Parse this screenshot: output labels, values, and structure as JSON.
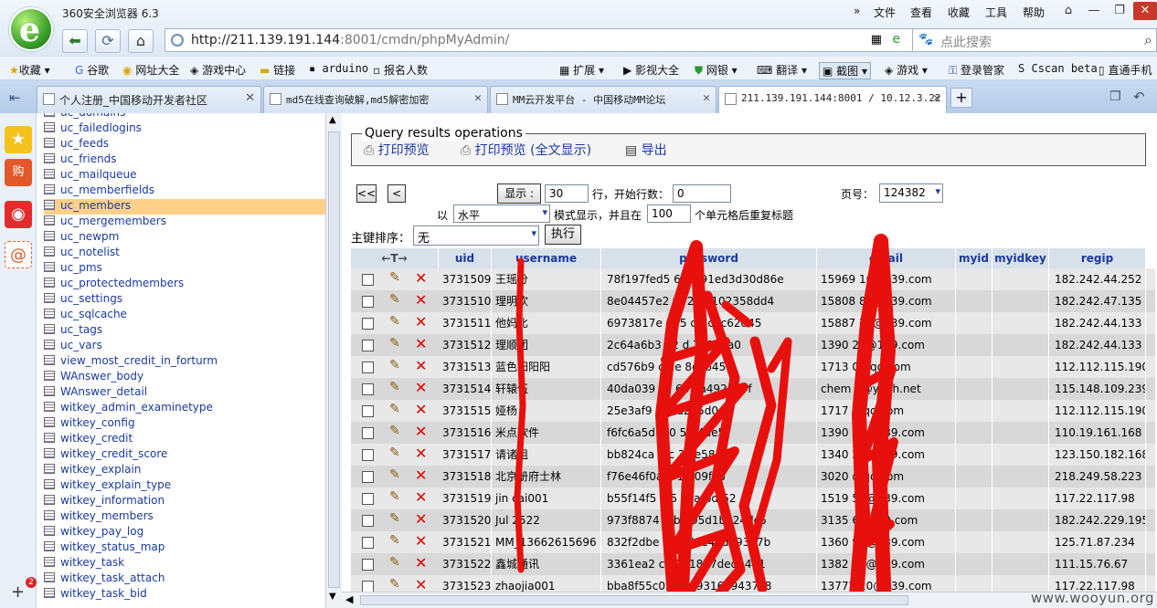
{
  "browser": {
    "app_name": "360安全浏览器 6.3",
    "menu": [
      "文件",
      "查看",
      "收藏",
      "工具",
      "帮助"
    ],
    "url_host": "http://211.139.191.144",
    "url_rest": ":8001/cmdn/phpMyAdmin/",
    "search_placeholder": "点此搜索"
  },
  "bookmarks_left": [
    "收藏",
    "谷歌",
    "网址大全",
    "游戏中心",
    "链接",
    "arduino",
    "报名人数"
  ],
  "bookmarks_right": [
    "扩展",
    "影视大全",
    "网银",
    "翻译",
    "截图",
    "游戏",
    "登录管家",
    "Cscan beta",
    "直通手机"
  ],
  "tabs": [
    "个人注册_中国移动开发者社区",
    "md5在线查询破解,md5解密加密",
    "MM云开发平台 - 中国移动MM论坛",
    "211.139.191.144:8001 / 10.12.3.22"
  ],
  "sidebar_badge": "2",
  "table_list": [
    "uc_domains",
    "uc_failedlogins",
    "uc_feeds",
    "uc_friends",
    "uc_mailqueue",
    "uc_memberfields",
    "uc_members",
    "uc_mergemembers",
    "uc_newpm",
    "uc_notelist",
    "uc_pms",
    "uc_protectedmembers",
    "uc_settings",
    "uc_sqlcache",
    "uc_tags",
    "uc_vars",
    "view_most_credit_in_forturm",
    "WAnswer_body",
    "WAnswer_detail",
    "witkey_admin_examinetype",
    "witkey_config",
    "witkey_credit",
    "witkey_credit_score",
    "witkey_explain",
    "witkey_explain_type",
    "witkey_information",
    "witkey_members",
    "witkey_pay_log",
    "witkey_status_map",
    "witkey_task",
    "witkey_task_attach",
    "witkey_task_bid"
  ],
  "selected_table": "uc_members",
  "query_ops": {
    "legend": "Query results operations",
    "print": "打印预览",
    "print_full": "打印预览 (全文显示)",
    "export": "导出"
  },
  "nav": {
    "first": "<<",
    "prev": "<",
    "show_btn": "显示 :",
    "rows_value": "30",
    "rows_label": "行，开始行数：",
    "start_value": "0",
    "page_label": "页号：",
    "page_value": "124382",
    "mode_prefix": "以",
    "mode_value": "水平",
    "mode_label": "模式显示，并且在",
    "repeat_value": "100",
    "repeat_label": "个单元格后重复标题",
    "sort_label": "主键排序：",
    "sort_value": "无",
    "exec_btn": "执行"
  },
  "columns": [
    "uid",
    "username",
    "password",
    "email",
    "myid",
    "myidkey",
    "regip"
  ],
  "rows": [
    [
      "3731509",
      "王瑶分",
      "78f197fed5    60cd91ed3d30d86e",
      "15969    16@139.com",
      "182.242.44.252"
    ],
    [
      "3731510",
      "理明欢",
      "8e04457e2   f9   26   0102358dd4",
      "15808    82@139.com",
      "182.242.47.135"
    ],
    [
      "3731511",
      "他妈比",
      "6973817e   025   d   7c5c62d45",
      "15887    73@139.com",
      "182.242.44.133"
    ],
    [
      "3731512",
      "理顺团",
      "2c64a6b3   b2   d   729a3a0",
      "1390    26@139.com",
      "182.242.44.133"
    ],
    [
      "3731513",
      "蓝色阳阳阳",
      "cd576b9   c2   e   8c8645a",
      "1713    0@qq.com",
      "112.112.115.190"
    ],
    [
      "3731514",
      "轩辕伍",
      "40da039   c1   68   aa492e09f",
      "chem    n@yeah.net",
      "115.148.109.239"
    ],
    [
      "3731515",
      "娅杨",
      "25e3af9   5   4   d2d5d049",
      "1717    @qq.com",
      "112.112.115.190"
    ],
    [
      "3731516",
      "米点软件",
      "f6fc6a5d   2   0   5f74ae5",
      "1390    67@139.com",
      "110.19.161.168"
    ],
    [
      "3731517",
      "请诸祖",
      "bb824ca   d   c   3   ce58321",
      "1340    29@139.com",
      "123.150.182.168"
    ],
    [
      "3731518",
      "北京册府士林",
      "f76e46f0a   4   1   309fa5",
      "3020    @qq.com",
      "218.249.58.223"
    ],
    [
      "3731519",
      "jin   cai001",
      "b55f14f5   7   5   cdafbdf52",
      "1519    58@139.com",
      "117.22.117.98"
    ],
    [
      "3731520",
      "Jul   2522",
      "973f8874   2   b0   95d1b924dc5",
      "3135    6@139.com",
      "182.242.229.195"
    ],
    [
      "3731521",
      "MM_13662615696",
      "832f2dbe   3   23d0e4dd49357b",
      "1360    96@139.com",
      "125.71.87.234"
    ],
    [
      "3731522",
      "鑫城通讯",
      "3361ea2   c   8921817ded1481",
      "1382    88@139.com",
      "111.15.76.67"
    ],
    [
      "3731523",
      "zhaojia001",
      "bba8f55c03   a3a9316e9437c8",
      "13772    20@139.com",
      "117.22.117.98"
    ]
  ],
  "watermark": "www.wooyun.org",
  "colors": {
    "link": "#1a3a9e",
    "header_bg": "#d8e0ea",
    "selected": "#ffd08a",
    "redaction": "#e8100c"
  }
}
